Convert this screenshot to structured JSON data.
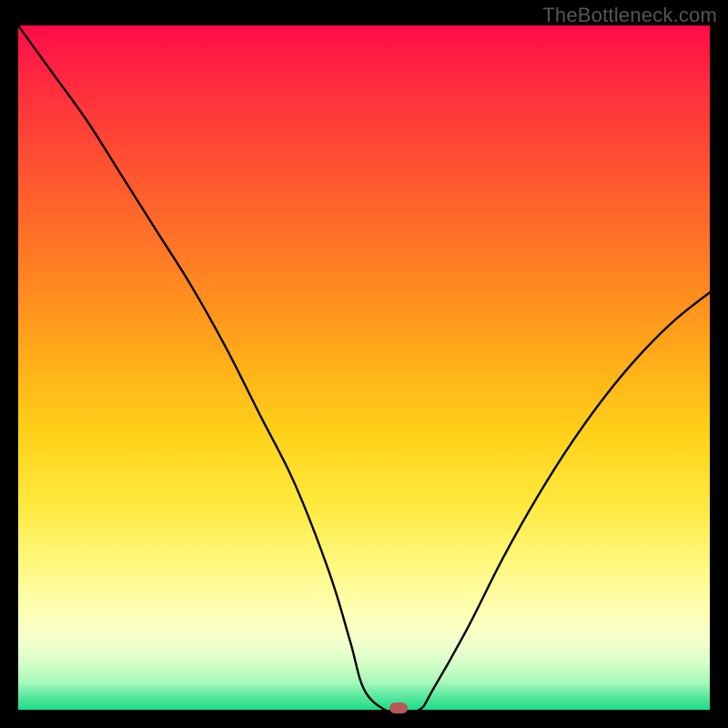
{
  "watermark": "TheBottleneck.com",
  "chart_data": {
    "type": "line",
    "title": "",
    "xlabel": "",
    "ylabel": "",
    "xlim": [
      0,
      100
    ],
    "ylim": [
      0,
      100
    ],
    "x": [
      0,
      5,
      10,
      15,
      20,
      25,
      30,
      35,
      40,
      45,
      48,
      50,
      53,
      55,
      58,
      60,
      65,
      70,
      75,
      80,
      85,
      90,
      95,
      100
    ],
    "values": [
      100,
      93,
      86,
      78,
      70,
      62,
      53,
      43,
      33,
      20,
      10,
      3,
      0,
      0,
      0,
      3,
      12,
      22,
      31,
      39,
      46,
      52,
      57,
      61
    ],
    "note": "Approximate V-shaped bottleneck curve. Minimum (0) near x≈53–58.",
    "marker": {
      "x": 55,
      "y": 0,
      "color": "#b65a55"
    },
    "background_gradient_top_to_bottom": [
      "#ff0a49",
      "#ff4a34",
      "#ff8f1f",
      "#ffd21a",
      "#fff77a",
      "#f4ffcd",
      "#a6f9b9",
      "#1bdc86"
    ]
  }
}
